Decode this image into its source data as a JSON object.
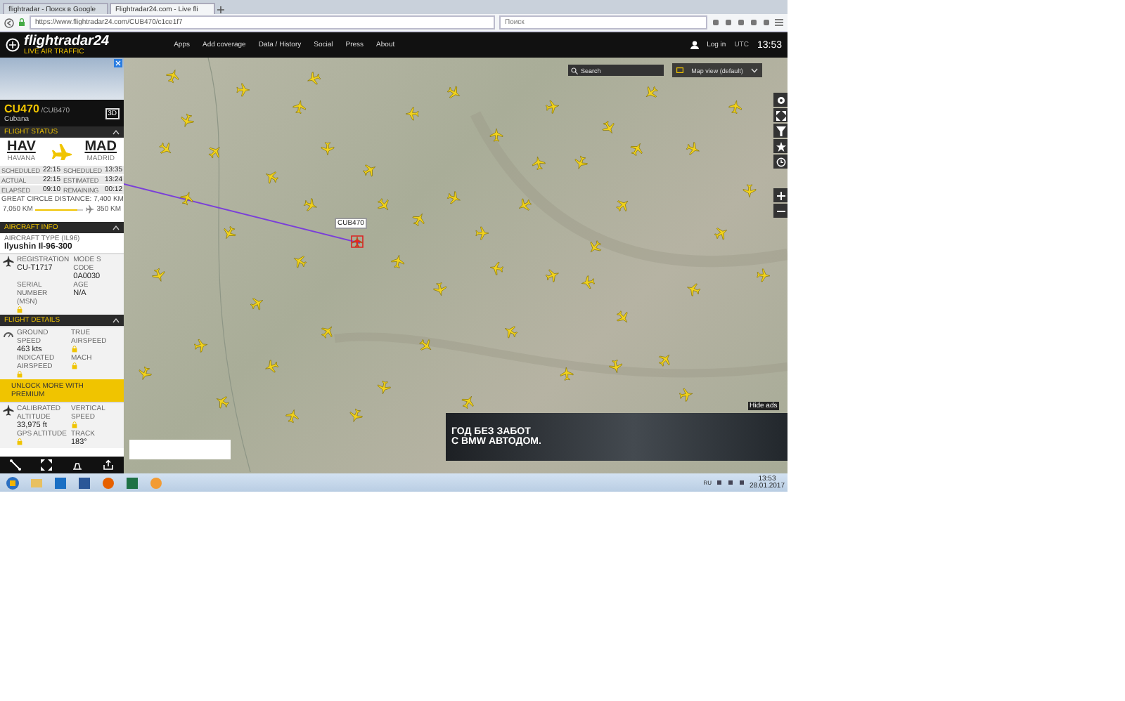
{
  "browser": {
    "tabs": [
      {
        "label": "flightradar - Поиск в Google",
        "selected": false
      },
      {
        "label": "Flightradar24.com - Live fli",
        "selected": true
      }
    ],
    "url": "https://www.flightradar24.com/CUB470/c1ce1f7",
    "search": {
      "placeholder": "Поиск"
    }
  },
  "site_nav": {
    "logo": "flightradar24",
    "tagline": "LIVE AIR TRAFFIC",
    "items": [
      "Apps",
      "Add coverage",
      "Data / History",
      "Social",
      "Press",
      "About"
    ],
    "login": "Log in",
    "timezone": "UTC",
    "time": "13:53"
  },
  "flight_panel": {
    "flight": "CU470",
    "callsign": "/CUB470",
    "airline": "Cubana",
    "view_3d": "3D",
    "status": {
      "title": "FLIGHT STATUS",
      "origin": {
        "code": "HAV",
        "city": "HAVANA"
      },
      "destination": {
        "code": "MAD",
        "city": "MADRID"
      },
      "times": [
        {
          "left_label": "SCHEDULED",
          "left_value": "22:15",
          "right_label": "SCHEDULED",
          "right_value": "13:35"
        },
        {
          "left_label": "ACTUAL",
          "left_value": "22:15",
          "right_label": "ESTIMATED",
          "right_value": "13:24"
        },
        {
          "left_label": "ELAPSED",
          "left_value": "09:10",
          "right_label": "REMAINING",
          "right_value": "00:12"
        }
      ],
      "distance_label": "GREAT CIRCLE DISTANCE: 7,400 KM",
      "flown": "7,050 KM",
      "remaining": "350 KM",
      "level": 0.9
    },
    "aircraft": {
      "title": "AIRCRAFT INFO",
      "type_label": "AIRCRAFT TYPE (IL96)",
      "type": "Ilyushin Il-96-300",
      "fields": [
        {
          "label": "REGISTRATION",
          "value": "CU-T1717"
        },
        {
          "label": "MODE S CODE",
          "value": "0A0030"
        },
        {
          "label": "SERIAL NUMBER (MSN)",
          "locked": true
        },
        {
          "label": "AGE",
          "value": "N/A"
        }
      ]
    },
    "details": {
      "title": "FLIGHT DETAILS",
      "fields": [
        {
          "label": "GROUND SPEED",
          "value": "463 kts"
        },
        {
          "label": "TRUE AIRSPEED",
          "locked": true
        },
        {
          "label": "INDICATED AIRSPEED",
          "locked": true
        },
        {
          "label": "MACH",
          "locked": true
        }
      ],
      "premium": "UNLOCK MORE WITH PREMIUM",
      "fields_2": [
        {
          "label": "CALIBRATED ALTITUDE",
          "value": "33,975 ft"
        },
        {
          "label": "VERTICAL SPEED",
          "locked": true
        },
        {
          "label": "GPS ALTITUDE",
          "locked": true
        },
        {
          "label": "TRACK",
          "value": "183°"
        }
      ]
    }
  },
  "map": {
    "search": {
      "placeholder": "Search"
    },
    "view": "Map view (default)",
    "flight_label": "CUB470",
    "ad": {
      "headline": [
        "ГОД БЕЗ ЗАБОТ",
        "С BMW АВТОДОМ."
      ],
      "hide": "Hide ads"
    }
  },
  "taskbar": {
    "language": "RU",
    "time": "13:53",
    "date": "28.01.2017"
  }
}
